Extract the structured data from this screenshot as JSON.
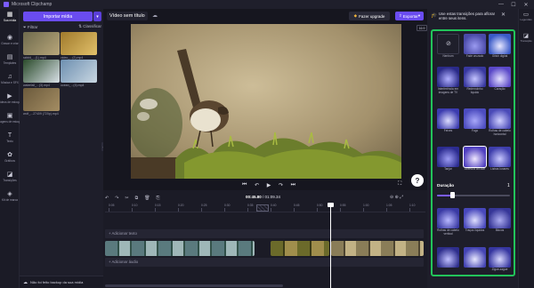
{
  "window": {
    "app_title": "Microsoft Clipchamp",
    "controls": [
      "—",
      "☐",
      "✕"
    ]
  },
  "left_rail": {
    "items": [
      {
        "id": "media",
        "label": "Sua mídia",
        "icon": "▦"
      },
      {
        "id": "record",
        "label": "Gravar e criar",
        "icon": "◉"
      },
      {
        "id": "templates",
        "label": "Templates",
        "icon": "▤"
      },
      {
        "id": "music",
        "label": "Música e SFX",
        "icon": "♫"
      },
      {
        "id": "stock-video",
        "label": "Vídeos de estoque",
        "icon": "▶"
      },
      {
        "id": "stock-images",
        "label": "Imagens de estoque",
        "icon": "▣"
      },
      {
        "id": "text",
        "label": "Texto",
        "icon": "T"
      },
      {
        "id": "graphics",
        "label": "Gráficos",
        "icon": "✿"
      },
      {
        "id": "transitions",
        "label": "Transições",
        "icon": "◪"
      },
      {
        "id": "brand-kit",
        "label": "Kit de marca",
        "icon": "◈"
      }
    ]
  },
  "media_panel": {
    "import_label": "Importar mídia",
    "import_dropdown": "▾",
    "filter_label": "Filtrar",
    "sort_label": "Classificar",
    "items": [
      {
        "name": "rabbit_...(1).mp4",
        "color_a": "#6e6a4d",
        "color_b": "#b8a67a"
      },
      {
        "name": "video_...(2).mp4",
        "color_a": "#a07a2c",
        "color_b": "#e1c06a"
      },
      {
        "name": "waterfall_...(3).mp4",
        "color_a": "#2a4a2a",
        "color_b": "#d8e0e6"
      },
      {
        "name": "ocean_...(4).mp4",
        "color_a": "#6d8fb0",
        "color_b": "#c9d7e2"
      },
      {
        "name": "wolf_...27409 (720p).mp4",
        "color_a": "#6b5a3c",
        "color_b": "#a48d63"
      }
    ],
    "backup_text": "Não foi feito backup da sua mídia",
    "backup_icon": "☁"
  },
  "header": {
    "project_title": "Vídeo sem título",
    "upgrade_label": "Fazer upgrade",
    "export_label": "Exportar",
    "export_dropdown": "▾"
  },
  "preview": {
    "aspect_ratio": "16:9",
    "controls": [
      "⏮",
      "↶",
      "▶",
      "↷",
      "⏭"
    ],
    "help_label": "?"
  },
  "timeline": {
    "tools": [
      "↶",
      "↷",
      "✂",
      "⧉",
      "🗑",
      "⎘"
    ],
    "current_time": "00:45.80",
    "total_time": "01:09.34",
    "zoom": "⊖  ⊕  ⤢",
    "ticks": [
      "0:05",
      "0:10",
      "0:15",
      "0:20",
      "0:25",
      "0:30",
      "0:35",
      "0:40",
      "0:45",
      "0:50",
      "0:55",
      "1:00",
      "1:05",
      "1:10"
    ],
    "add_text_label": "+ Adicionar texto",
    "add_audio_label": "+ Adicionar áudio"
  },
  "transitions_panel": {
    "tip_text": "Use estas transições para aflorar entre seus itens.",
    "tip_icon": "🎓",
    "close_label": "✕",
    "items": [
      {
        "label": "Nenhum",
        "c1": "#1f1f2b",
        "c2": "#1f1f2b"
      },
      {
        "label": "Fade cruzado",
        "c1": "#4a4aa8",
        "c2": "#9a9af0"
      },
      {
        "label": "Glitch digital",
        "c1": "#3a5ac8",
        "c2": "#e8e8ff"
      },
      {
        "label": "Interferência em imagens de TV",
        "c1": "#2a2a88",
        "c2": "#b0b0ff"
      },
      {
        "label": "Redemoinho líquido",
        "c1": "#3838a0",
        "c2": "#c4c4ff"
      },
      {
        "label": "Coração",
        "c1": "#5a48c8",
        "c2": "#e4e0ff"
      },
      {
        "label": "Feixes",
        "c1": "#3c3cb0",
        "c2": "#dcdcff"
      },
      {
        "label": "Fogo",
        "c1": "#4c4cc0",
        "c2": "#a8a8f8"
      },
      {
        "label": "Rolhas de cabelo horizontal",
        "c1": "#4a4ab8",
        "c2": "#d0d0ff"
      },
      {
        "label": "Tanjar",
        "c1": "#2c2c90",
        "c2": "#9c9cf4"
      },
      {
        "label": "Abertura circular",
        "c1": "#5040c0",
        "c2": "#f0e8ff"
      },
      {
        "label": "Listras lunares",
        "c1": "#3e3eac",
        "c2": "#c8c8ff"
      },
      {
        "label": "Rolhas de cabelo vertical",
        "c1": "#3a3aa4",
        "c2": "#b8b8ff"
      },
      {
        "label": "Traços líquidos",
        "c1": "#4848bc",
        "c2": "#e0e0ff"
      },
      {
        "label": "Blocos",
        "c1": "#363698",
        "c2": "#acacf0"
      },
      {
        "label": "",
        "c1": "#2e2e8c",
        "c2": "#c0c0ff"
      },
      {
        "label": "",
        "c1": "#4444b4",
        "c2": "#e8e8ff"
      },
      {
        "label": "Zigue-zague",
        "c1": "#3636a0",
        "c2": "#d8d8ff"
      }
    ],
    "duration_title": "Duração",
    "duration_value": "1",
    "duration_fraction": 0.2
  },
  "right_rail": {
    "items": [
      {
        "id": "subtitles",
        "label": "Legendas",
        "icon": "▭"
      },
      {
        "id": "transition",
        "label": "Transição",
        "icon": "◪"
      }
    ]
  }
}
